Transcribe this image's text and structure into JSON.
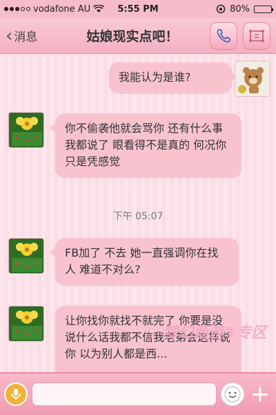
{
  "status_bar": {
    "carrier": "vodafone AU",
    "time": "5:55 PM",
    "battery": "80%",
    "battery_level": 0.8
  },
  "nav": {
    "back_label": "消息",
    "title": "姑娘现实点吧！"
  },
  "messages": [
    {
      "side": "right",
      "text": "我能认为是谁?"
    },
    {
      "side": "left",
      "text": "你不偷袭他就会骂你 还有什么事 我都说了 眼看得不是真的  何况你只是凭感觉"
    },
    {
      "side": "left",
      "text": "FB加了 不去 她一直强调你在找人 难道不对么?"
    },
    {
      "side": "left",
      "text": "让你找你就找不就完了  你要是没说什么话我都不信我老弟会这样说你  以为别人都是西..."
    }
  ],
  "timestamp": "下午 05:07",
  "watermark": "梦幻西游②专区",
  "input": {
    "placeholder": ""
  }
}
